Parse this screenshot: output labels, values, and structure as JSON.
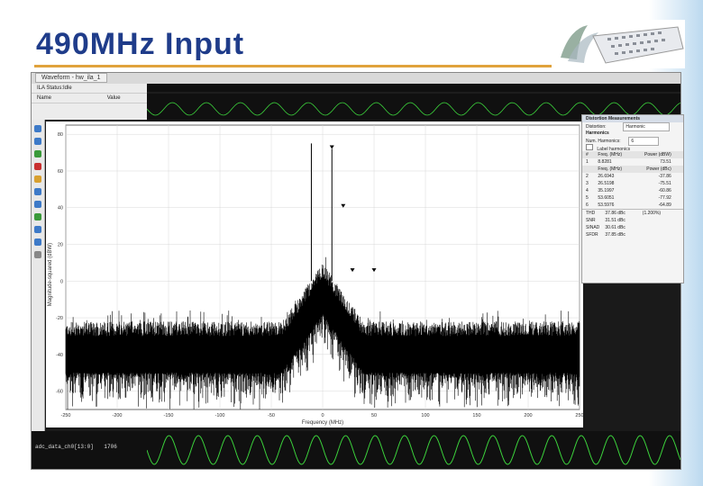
{
  "slide": {
    "title": "490MHz Input",
    "accent_color": "#1f3c8a",
    "rule_color": "#e0a23c"
  },
  "waveform_window": {
    "title": "Waveform - hw_ila_1",
    "ila_panel": {
      "name": "ILA Status:Idle",
      "col_name": "Name",
      "col_value": "Value"
    },
    "bottom_signal_label": "adc_data_ch0[13:0]",
    "bottom_signal_value": "1706"
  },
  "spectrum_plot": {
    "ylabel": "Magnitude-squared (dBW)",
    "xlabel": "Frequency (MHz)"
  },
  "chart_data": {
    "type": "line",
    "xlabel": "Frequency (MHz)",
    "ylabel": "Magnitude-squared (dBW)",
    "xlim": [
      -250,
      250
    ],
    "ylim": [
      -70,
      85
    ],
    "x_ticks": [
      "-250",
      "-200",
      "-150",
      "-100",
      "-50",
      "0",
      "50",
      "100",
      "150",
      "200",
      "250"
    ],
    "y_ticks": [
      "80",
      "60",
      "40",
      "20",
      "0",
      "-20",
      "-40",
      "-60"
    ],
    "grid": true,
    "noise_floor": -30,
    "peaks": [
      {
        "x": -11,
        "y": 75
      },
      {
        "x": 9,
        "y": 72
      }
    ],
    "markers": [
      {
        "x": 9,
        "y": 72
      },
      {
        "x": 20,
        "y": 40
      },
      {
        "x": 29,
        "y": 5
      },
      {
        "x": 50,
        "y": 5
      }
    ]
  },
  "measurements": {
    "title": "Distortion Measurements",
    "distortion_label": "Distortion:",
    "distortion_value": "Harmonic",
    "harmonics_label": "Harmonics",
    "num_harmonics_label": "Num. Harmonics:",
    "num_harmonics_value": "6",
    "label_harmonics": "Label harmonics",
    "header": [
      "#",
      "Freq. (MHz)",
      "Power (dBW)"
    ],
    "header2": [
      "",
      "Freq. (MHz)",
      "Power (dBc)"
    ],
    "fundamental": [
      "1",
      "8.8281",
      "73.51"
    ],
    "rows": [
      [
        "2",
        "26.6943",
        "-37.86"
      ],
      [
        "3",
        "26.5198",
        "-75.51"
      ],
      [
        "4",
        "35.1997",
        "-60.86"
      ],
      [
        "5",
        "53.6051",
        "-77.92"
      ],
      [
        "6",
        "53.5976",
        "-64.89"
      ]
    ],
    "thd": [
      "THD",
      "37.86 dBc",
      "(1.200%)"
    ],
    "snr": [
      "SNR",
      "31.51 dBc"
    ],
    "sinad": [
      "SINAD",
      "30.61 dBc"
    ],
    "sfdr": [
      "SFDR",
      "37.85 dBc"
    ]
  }
}
